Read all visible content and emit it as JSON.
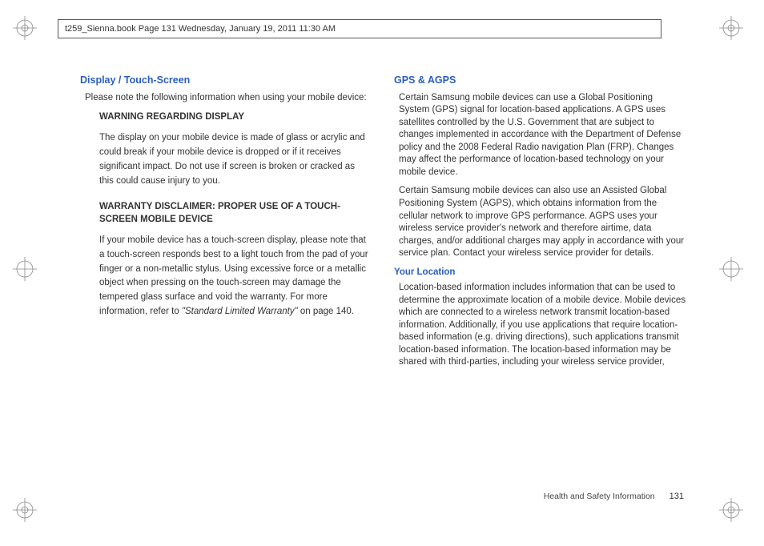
{
  "header": {
    "file_info": "t259_Sienna.book  Page 131  Wednesday, January 19, 2011  11:30 AM"
  },
  "left_column": {
    "heading": "Display / Touch-Screen",
    "intro": "Please note the following information when using your mobile device:",
    "warn1_title": "WARNING REGARDING DISPLAY",
    "warn1_body": "The display on your mobile device is made of glass or acrylic and could break if your mobile device is dropped or if it receives significant impact. Do not use if screen is broken or cracked as this could cause injury to you.",
    "warn2_title": "WARRANTY DISCLAIMER: PROPER USE OF A TOUCH-SCREEN MOBILE DEVICE",
    "warn2_body_a": "If your mobile device has a touch-screen display, please note that a touch-screen responds best to a light touch from the pad of your finger or a non-metallic stylus. Using excessive force or a metallic object when pressing on the touch-screen may damage the tempered glass surface and void the warranty. For more information, refer to ",
    "warn2_body_ital": "\"Standard Limited Warranty\"",
    "warn2_body_b": "  on page 140."
  },
  "right_column": {
    "heading": "GPS & AGPS",
    "p1": "Certain Samsung mobile devices can use a Global Positioning System (GPS) signal for location-based applications. A GPS uses satellites controlled by the U.S. Government that are subject to changes implemented in accordance with the Department of Defense policy and the 2008 Federal Radio navigation Plan (FRP). Changes may affect the performance of location-based technology on your mobile device.",
    "p2": "Certain Samsung mobile devices can also use an Assisted Global Positioning System (AGPS), which obtains information from the cellular network to improve GPS performance. AGPS uses your wireless service provider's network and therefore airtime, data charges, and/or additional charges may apply in accordance with your service plan. Contact your wireless service provider for details.",
    "sub_heading": "Your Location",
    "p3": "Location-based information includes information that can be used to determine the approximate location of a mobile device. Mobile devices which are connected to a wireless network transmit location-based information. Additionally, if you use applications that require location-based information (e.g. driving directions), such applications transmit location-based information. The location-based information may be shared with third-parties, including your wireless service provider,"
  },
  "footer": {
    "section": "Health and Safety Information",
    "page": "131"
  }
}
